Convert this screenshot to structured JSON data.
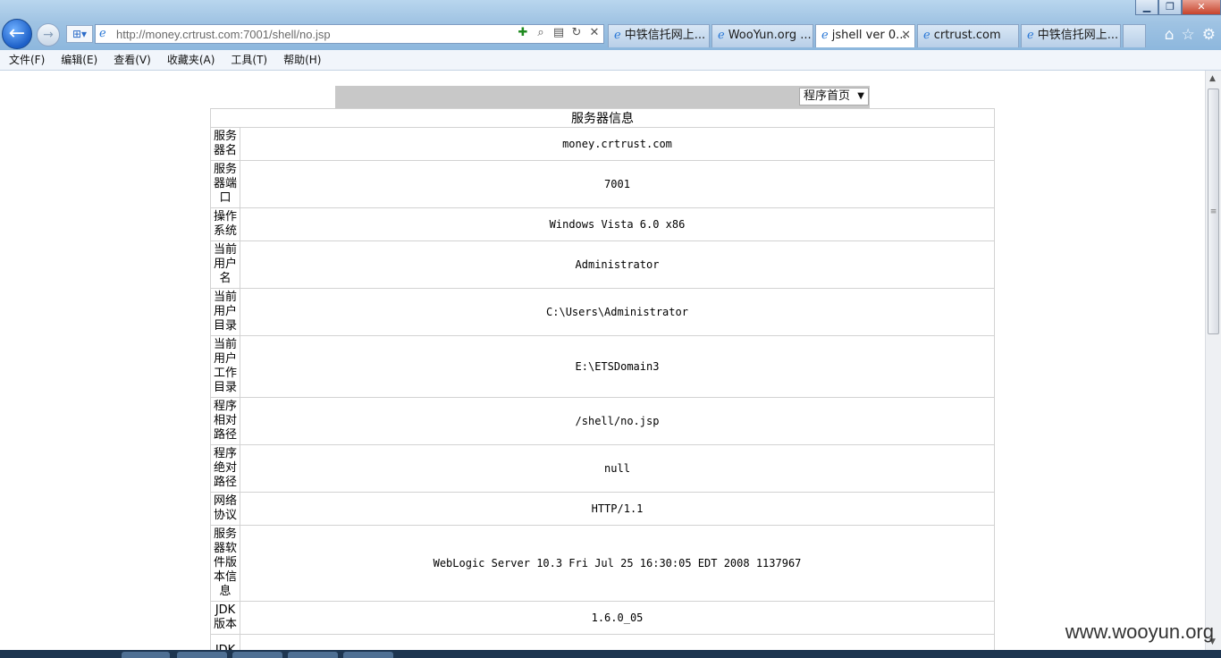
{
  "browser": {
    "address": "http://money.crtrust.com:7001/shell/no.jsp",
    "window_controls": {
      "minimize": "▁",
      "maximize": "❐",
      "close": "✕"
    },
    "tabs": [
      {
        "label": "中铁信托网上...",
        "active": false,
        "closable": false
      },
      {
        "label": "WooYun.org ...",
        "active": false,
        "closable": false
      },
      {
        "label": "jshell ver 0...",
        "active": true,
        "closable": true
      },
      {
        "label": "crtrust.com",
        "active": false,
        "closable": false
      },
      {
        "label": "中铁信托网上...",
        "active": false,
        "closable": false
      }
    ],
    "menu": [
      "文件(F)",
      "编辑(E)",
      "查看(V)",
      "收藏夹(A)",
      "工具(T)",
      "帮助(H)"
    ]
  },
  "page": {
    "program_select": "程序首页",
    "table_title": "服务器信息",
    "rows": [
      {
        "label": "服务器名",
        "value": "money.crtrust.com"
      },
      {
        "label": "服务器端口",
        "value": "7001"
      },
      {
        "label": "操作系统",
        "value": "Windows Vista 6.0 x86"
      },
      {
        "label": "当前用户名",
        "value": "Administrator"
      },
      {
        "label": "当前用户目录",
        "value": "C:\\Users\\Administrator"
      },
      {
        "label": "当前用户工作目录",
        "value": "E:\\ETSDomain3"
      },
      {
        "label": "程序相对路径",
        "value": "/shell/no.jsp"
      },
      {
        "label": "程序绝对路径",
        "value": "null"
      },
      {
        "label": "网络协议",
        "value": "HTTP/1.1"
      },
      {
        "label": "服务器软件版本信息",
        "value": "WebLogic Server 10.3 Fri Jul 25 16:30:05 EDT 2008 1137967"
      },
      {
        "label": "JDK版本",
        "value": "1.6.0_05"
      },
      {
        "label": "JDK",
        "value": ""
      }
    ]
  },
  "watermark": "www.wooyun.org"
}
